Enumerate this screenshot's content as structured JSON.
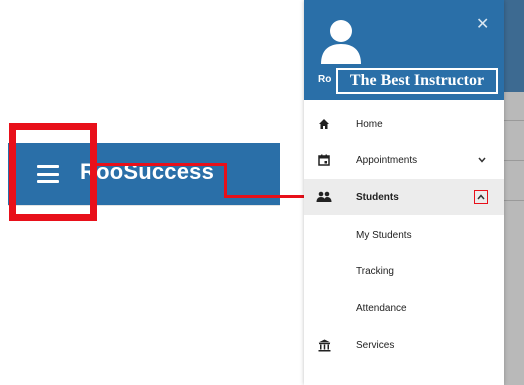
{
  "app": {
    "brand": "RooSuccess"
  },
  "drawer": {
    "header_short_label": "Ro",
    "instructor_label": "The Best Instructor",
    "close_icon": "close-icon",
    "items": [
      {
        "label": "Home",
        "icon": "home-icon"
      },
      {
        "label": "Appointments",
        "icon": "calendar-icon",
        "expander": "chevron-down-icon"
      },
      {
        "label": "Students",
        "icon": "people-icon",
        "expander": "chevron-up-icon",
        "active": true
      },
      {
        "label": "My Students",
        "icon": ""
      },
      {
        "label": "Tracking",
        "icon": ""
      },
      {
        "label": "Attendance",
        "icon": ""
      },
      {
        "label": "Services",
        "icon": "institution-icon"
      }
    ]
  },
  "colors": {
    "header_blue": "#2a6fa8",
    "highlight_red": "#e8101a",
    "active_row": "#ececec"
  }
}
